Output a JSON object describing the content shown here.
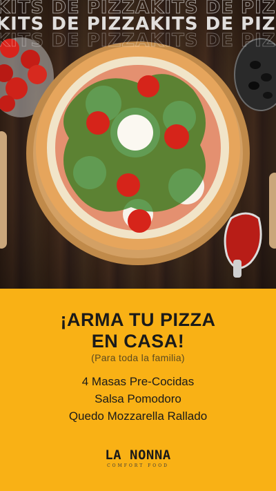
{
  "watermark": {
    "text": "KITS DE PIZZAKITS DE PIZZA"
  },
  "promo": {
    "headline_line1": "¡ARMA TU PIZZA",
    "headline_line2": "EN CASA!",
    "subtitle": "(Para toda la familia)",
    "items": [
      "4 Masas Pre-Cocidas",
      "Salsa Pomodoro",
      "Quedo Mozzarella Rallado"
    ]
  },
  "brand": {
    "name": "LA NONNA",
    "tagline": "COMFORT FOOD"
  },
  "colors": {
    "background_yellow": "#f9b115",
    "text_dark": "#1a1a1a",
    "wood": "#3b2619"
  }
}
